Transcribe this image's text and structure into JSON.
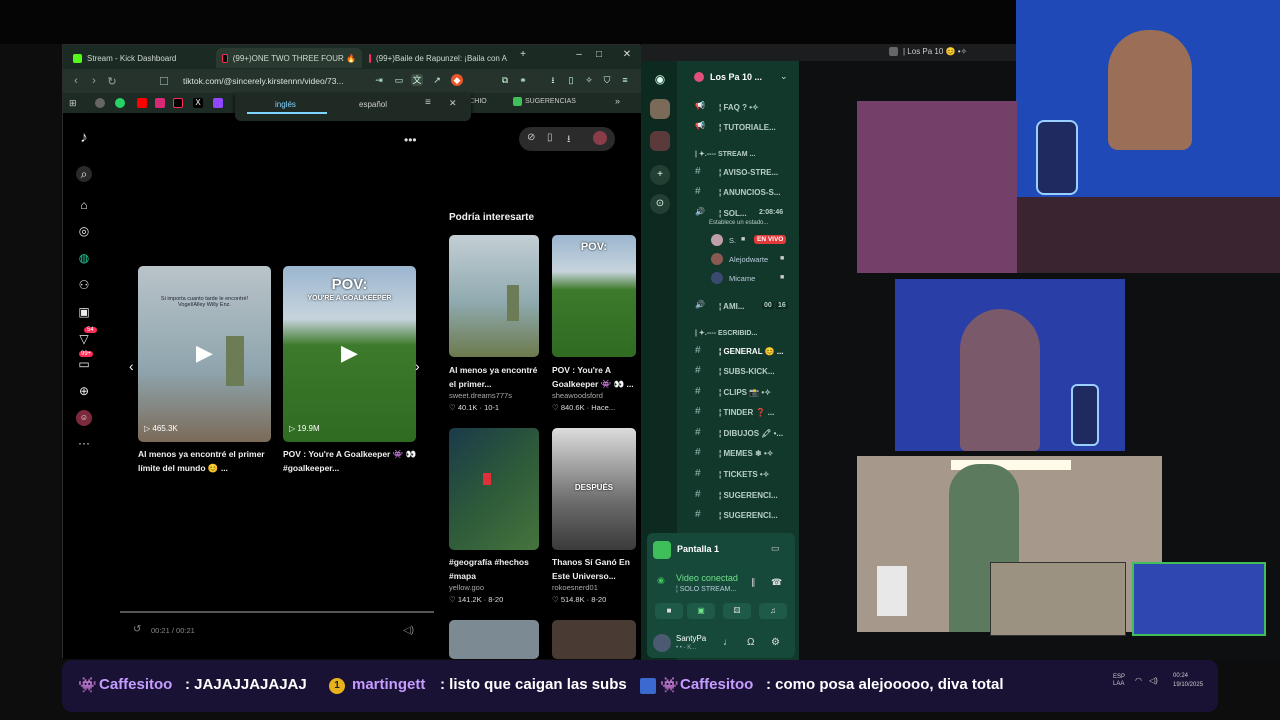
{
  "browser": {
    "tabs": [
      {
        "label": "Stream - Kick Dashboard"
      },
      {
        "label": "(99+)ONE TWO THREE FOUR 🔥"
      },
      {
        "label": "(99+)Baile de Rapunzel: ¡Baila con A"
      }
    ],
    "url": "tiktok.com/@sincerely.kirstennn/video/73...",
    "bookmarks": [
      {
        "label": "ITCHIO"
      },
      {
        "label": "SUGERENCIAS"
      }
    ],
    "translate": {
      "left": "inglés",
      "right": "español"
    }
  },
  "tiktok": {
    "sidebar_badges": {
      "notifications": "54",
      "messages": "99+"
    },
    "section_title": "Podría interesarte",
    "main_cards": [
      {
        "overlay": "Si importa cuanto tarde le encontré! Vogel/Alley Willy Enz.",
        "views": "465.3K",
        "title": "Al menos ya encontré el primer límite del mundo 😊 ..."
      },
      {
        "overlay": "POV: YOU'RE A GOALKEEPER",
        "views": "19.9M",
        "title": "POV : You're A Goalkeeper 👾 👀 #goalkeeper..."
      }
    ],
    "progress_time": "00:21 / 00:21",
    "suggestions": [
      {
        "title": "Al menos ya encontré el primer...",
        "author": "sweet.dreams777s",
        "likes": "40.1K",
        "date": "10-1"
      },
      {
        "title": "POV : You're A Goalkeeper 👾 👀 ...",
        "author": "sheawoodsford",
        "likes": "840.6K",
        "date": "Hace..."
      },
      {
        "title": "#geografía #hechos #mapa",
        "author": "yellow.goo",
        "likes": "141.2K",
        "date": "8-20"
      },
      {
        "title": "Thanos Sí Ganó En Este Universo...",
        "author": "rokoesnerd01",
        "likes": "514.8K",
        "date": "8-20"
      }
    ],
    "overlay_despues": "DESPUÉS",
    "overlay_pov": "POV:",
    "overlay_pov2": "YOU'RE A GOALKEEPER"
  },
  "discord": {
    "server": "Los Pa 10 ...",
    "window_title": "| Los Pa 10 😊 •✧",
    "channels": [
      {
        "name": "¦ FAQ ? •✧",
        "type": "announce"
      },
      {
        "name": "¦ TUTORIALE...",
        "type": "announce"
      },
      {
        "name": "| ✦.---- STREAM ...",
        "type": "category"
      },
      {
        "name": "¦ AVISO-STRE...",
        "type": "text"
      },
      {
        "name": "¦ ANUNCIOS-S...",
        "type": "text"
      },
      {
        "name": "¦ SOL...",
        "type": "voice",
        "timer": "2:08:46",
        "status": "Establece un estado..."
      },
      {
        "name": "¦ AMI...",
        "type": "voice",
        "count_a": "00",
        "count_b": "16"
      },
      {
        "name": "| ✦.---- ESCRIBID...",
        "type": "category"
      },
      {
        "name": "¦ GENERAL 😊 ...",
        "type": "text"
      },
      {
        "name": "¦ SUBS-KICK...",
        "type": "text"
      },
      {
        "name": "¦ CLIPS 📸 •✧",
        "type": "text"
      },
      {
        "name": "¦ TINDER ❓ ...",
        "type": "text"
      },
      {
        "name": "¦ DIBUJOS 🖍 •...",
        "type": "text"
      },
      {
        "name": "¦ MEMES ❄ •✧",
        "type": "text"
      },
      {
        "name": "¦ TICKETS •✧",
        "type": "text"
      },
      {
        "name": "¦ SUGERENCI...",
        "type": "text"
      },
      {
        "name": "¦ SUGERENCI...",
        "type": "text"
      }
    ],
    "voice_users": [
      {
        "name": "S.",
        "badge": "EN VIVO"
      },
      {
        "name": "Alejodwarte"
      },
      {
        "name": "Micame"
      }
    ],
    "screen_label": "Pantalla 1",
    "video_status": "Video conectad",
    "video_channel": "¦ SOLO STREAM...",
    "user": {
      "name": "SantyPa",
      "sub": "• • - K..."
    }
  },
  "chat": [
    {
      "user": "Caffesitoo",
      "msg": "JAJAJJAJAJAJ",
      "color": "#c59cff"
    },
    {
      "user": "martingett",
      "msg": "listo que caigan las subs",
      "color": "#c59cff"
    },
    {
      "user": "Caffesitoo",
      "msg": "como posa alejooooo, diva total",
      "color": "#c59cff"
    }
  ],
  "tray": {
    "lang": "ESP LAA",
    "time": "00:24",
    "date": "19/10/2025"
  },
  "colors": {
    "kick": "#53fc18",
    "discord_bg": "#12372b",
    "tiktok_red": "#fe2c55",
    "chat_bg": "#1a1235"
  }
}
